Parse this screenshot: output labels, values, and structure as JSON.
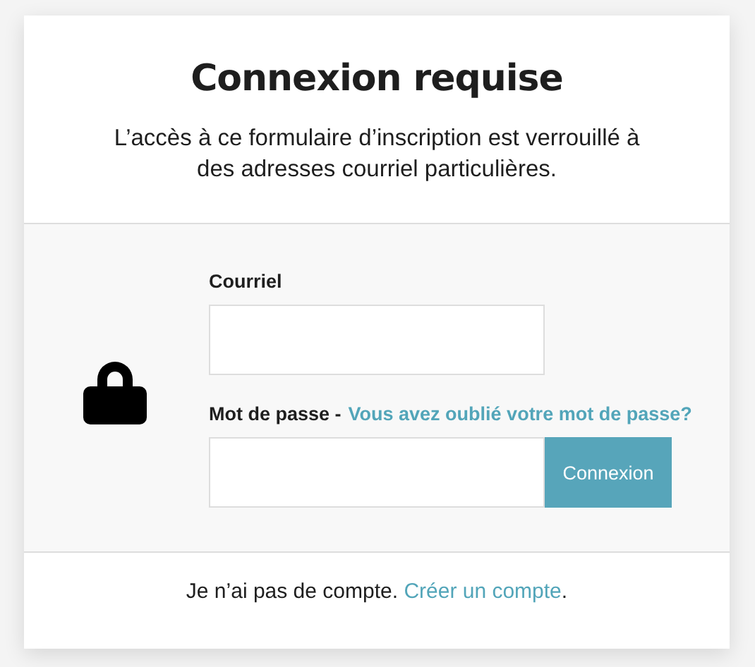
{
  "header": {
    "title": "Connexion requise",
    "description": "L’accès à ce formulaire d’inscription est verrouillé à des adresses courriel particulières."
  },
  "form": {
    "email_label": "Courriel",
    "password_label": "Mot de passe -",
    "forgot_link": "Vous avez oublié votre mot de passe?",
    "submit": "Connexion"
  },
  "footer": {
    "text": "Je n’ai pas de compte.",
    "link": "Créer un compte",
    "end": "."
  }
}
